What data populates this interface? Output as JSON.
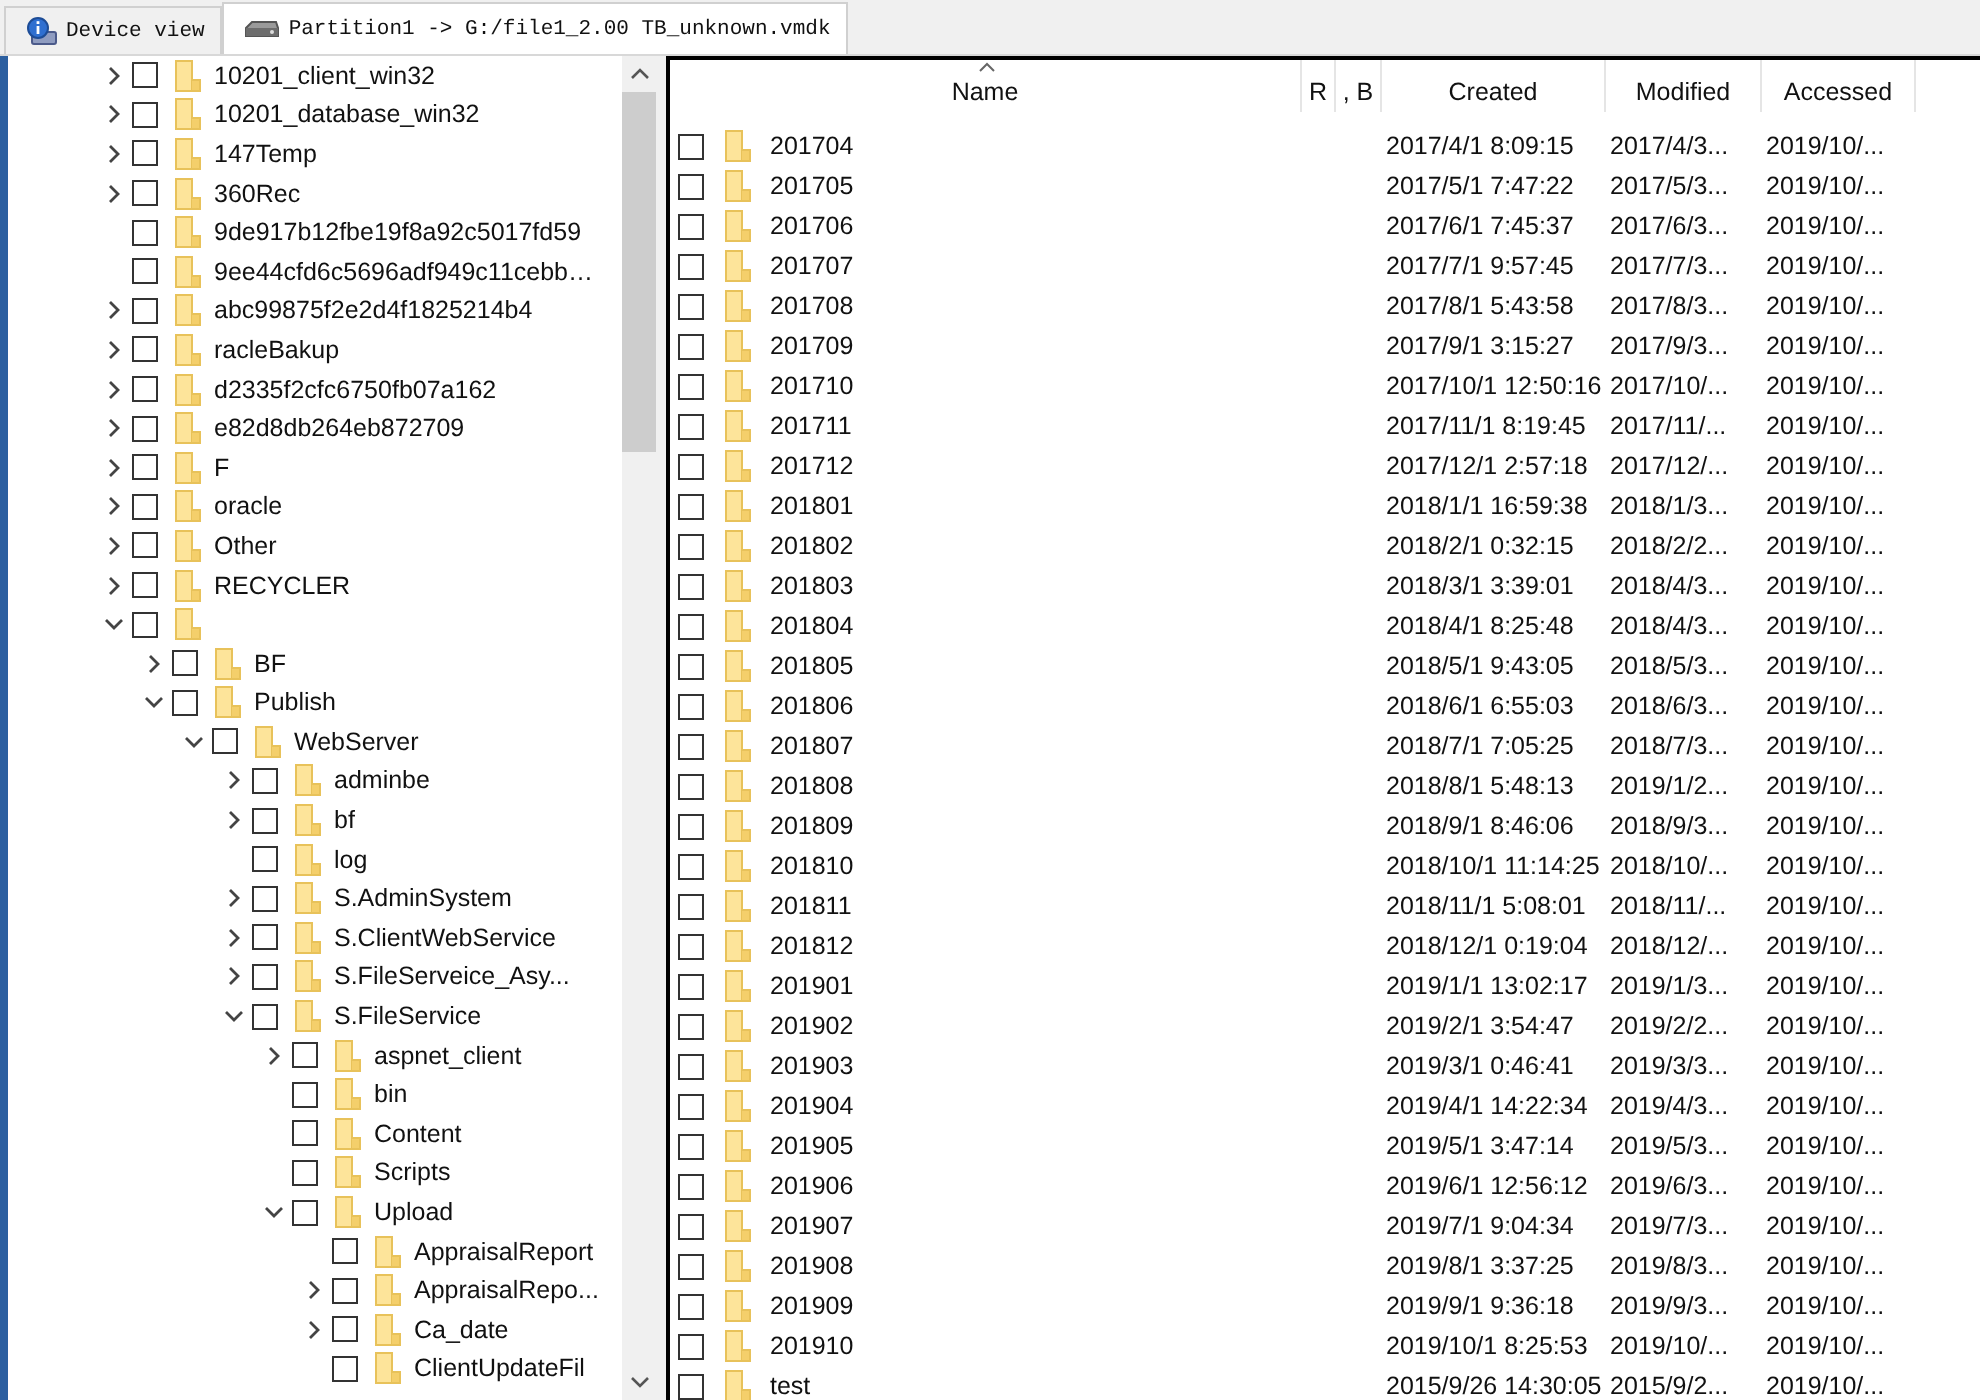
{
  "tabs": [
    {
      "label": "Device view",
      "kind": "device",
      "selected": false
    },
    {
      "label": "Partition1 -> G:/file1_2.00 TB_unknown.vmdk",
      "kind": "disk",
      "selected": true
    }
  ],
  "tree": [
    {
      "name": "10201_client_win32",
      "expanded": false,
      "checked": false
    },
    {
      "name": "10201_database_win32",
      "expanded": false,
      "checked": false
    },
    {
      "name": "147Temp",
      "expanded": false,
      "checked": false
    },
    {
      "name": "360Rec",
      "expanded": false,
      "checked": false
    },
    {
      "name": "9de917b12fbe19f8a92c5017fd59",
      "checked": false
    },
    {
      "name": "9ee44cfd6c5696adf949c11cebb…",
      "checked": false
    },
    {
      "name": "abc99875f2e2d4f1825214b4",
      "expanded": false,
      "checked": false
    },
    {
      "name": "racleBakup",
      "expanded": false,
      "checked": false
    },
    {
      "name": "d2335f2cfc6750fb07a162",
      "expanded": false,
      "checked": false
    },
    {
      "name": "e82d8db264eb872709",
      "expanded": false,
      "checked": false
    },
    {
      "name": "F",
      "expanded": false,
      "checked": false
    },
    {
      "name": "oracle",
      "expanded": false,
      "checked": false
    },
    {
      "name": "Other",
      "expanded": false,
      "checked": false
    },
    {
      "name": "RECYCLER",
      "expanded": false,
      "checked": false
    },
    {
      "expanded": true,
      "checked": false,
      "children": [
        {
          "name": "BF",
          "expanded": false,
          "checked": false
        },
        {
          "name": "Publish",
          "expanded": true,
          "checked": false,
          "children": [
            {
              "name": "WebServer",
              "expanded": true,
              "checked": false,
              "children": [
                {
                  "name": "adminbe",
                  "expanded": false,
                  "checked": false
                },
                {
                  "name": "bf",
                  "expanded": false,
                  "checked": false
                },
                {
                  "name": "log",
                  "checked": false
                },
                {
                  "name": "S.AdminSystem",
                  "expanded": false,
                  "checked": false
                },
                {
                  "name": "S.ClientWebService",
                  "expanded": false,
                  "checked": false
                },
                {
                  "name": "S.FileServeice_Asy...",
                  "expanded": false,
                  "checked": false
                },
                {
                  "name": "S.FileService",
                  "expanded": true,
                  "checked": false,
                  "children": [
                    {
                      "name": "aspnet_client",
                      "expanded": false,
                      "checked": false
                    },
                    {
                      "name": "bin",
                      "checked": false
                    },
                    {
                      "name": "Content",
                      "checked": false
                    },
                    {
                      "name": "Scripts",
                      "checked": false
                    },
                    {
                      "name": "Upload",
                      "expanded": true,
                      "checked": false,
                      "children": [
                        {
                          "name": "AppraisalReport",
                          "checked": false
                        },
                        {
                          "name": "AppraisalRepo...",
                          "expanded": false,
                          "checked": false
                        },
                        {
                          "name": "Ca_date",
                          "expanded": false,
                          "checked": false
                        },
                        {
                          "name": "ClientUpdateFil",
                          "checked": false
                        }
                      ]
                    }
                  ]
                }
              ]
            }
          ]
        }
      ]
    }
  ],
  "table": {
    "columns": [
      "Name",
      "R",
      ", B",
      "Created",
      "Modified",
      "Accessed"
    ],
    "rows": [
      {
        "name": "201704",
        "created": "2017/4/1 8:09:15",
        "modified": "2017/4/3...",
        "accessed": "2019/10/...",
        "checked": false
      },
      {
        "name": "201705",
        "created": "2017/5/1 7:47:22",
        "modified": "2017/5/3...",
        "accessed": "2019/10/...",
        "checked": false
      },
      {
        "name": "201706",
        "created": "2017/6/1 7:45:37",
        "modified": "2017/6/3...",
        "accessed": "2019/10/...",
        "checked": false
      },
      {
        "name": "201707",
        "created": "2017/7/1 9:57:45",
        "modified": "2017/7/3...",
        "accessed": "2019/10/...",
        "checked": false
      },
      {
        "name": "201708",
        "created": "2017/8/1 5:43:58",
        "modified": "2017/8/3...",
        "accessed": "2019/10/...",
        "checked": false
      },
      {
        "name": "201709",
        "created": "2017/9/1 3:15:27",
        "modified": "2017/9/3...",
        "accessed": "2019/10/...",
        "checked": false
      },
      {
        "name": "201710",
        "created": "2017/10/1 12:50:16",
        "modified": "2017/10/...",
        "accessed": "2019/10/...",
        "checked": false
      },
      {
        "name": "201711",
        "created": "2017/11/1 8:19:45",
        "modified": "2017/11/...",
        "accessed": "2019/10/...",
        "checked": false
      },
      {
        "name": "201712",
        "created": "2017/12/1 2:57:18",
        "modified": "2017/12/...",
        "accessed": "2019/10/...",
        "checked": false
      },
      {
        "name": "201801",
        "created": "2018/1/1 16:59:38",
        "modified": "2018/1/3...",
        "accessed": "2019/10/...",
        "checked": false
      },
      {
        "name": "201802",
        "created": "2018/2/1 0:32:15",
        "modified": "2018/2/2...",
        "accessed": "2019/10/...",
        "checked": false
      },
      {
        "name": "201803",
        "created": "2018/3/1 3:39:01",
        "modified": "2018/4/3...",
        "accessed": "2019/10/...",
        "checked": false
      },
      {
        "name": "201804",
        "created": "2018/4/1 8:25:48",
        "modified": "2018/4/3...",
        "accessed": "2019/10/...",
        "checked": false
      },
      {
        "name": "201805",
        "created": "2018/5/1 9:43:05",
        "modified": "2018/5/3...",
        "accessed": "2019/10/...",
        "checked": false
      },
      {
        "name": "201806",
        "created": "2018/6/1 6:55:03",
        "modified": "2018/6/3...",
        "accessed": "2019/10/...",
        "checked": false
      },
      {
        "name": "201807",
        "created": "2018/7/1 7:05:25",
        "modified": "2018/7/3...",
        "accessed": "2019/10/...",
        "checked": false
      },
      {
        "name": "201808",
        "created": "2018/8/1 5:48:13",
        "modified": "2019/1/2...",
        "accessed": "2019/10/...",
        "checked": false
      },
      {
        "name": "201809",
        "created": "2018/9/1 8:46:06",
        "modified": "2018/9/3...",
        "accessed": "2019/10/...",
        "checked": false
      },
      {
        "name": "201810",
        "created": "2018/10/1 11:14:25",
        "modified": "2018/10/...",
        "accessed": "2019/10/...",
        "checked": false
      },
      {
        "name": "201811",
        "created": "2018/11/1 5:08:01",
        "modified": "2018/11/...",
        "accessed": "2019/10/...",
        "checked": false
      },
      {
        "name": "201812",
        "created": "2018/12/1 0:19:04",
        "modified": "2018/12/...",
        "accessed": "2019/10/...",
        "checked": false
      },
      {
        "name": "201901",
        "created": "2019/1/1 13:02:17",
        "modified": "2019/1/3...",
        "accessed": "2019/10/...",
        "checked": false
      },
      {
        "name": "201902",
        "created": "2019/2/1 3:54:47",
        "modified": "2019/2/2...",
        "accessed": "2019/10/...",
        "checked": false
      },
      {
        "name": "201903",
        "created": "2019/3/1 0:46:41",
        "modified": "2019/3/3...",
        "accessed": "2019/10/...",
        "checked": false
      },
      {
        "name": "201904",
        "created": "2019/4/1 14:22:34",
        "modified": "2019/4/3...",
        "accessed": "2019/10/...",
        "checked": false
      },
      {
        "name": "201905",
        "created": "2019/5/1 3:47:14",
        "modified": "2019/5/3...",
        "accessed": "2019/10/...",
        "checked": false
      },
      {
        "name": "201906",
        "created": "2019/6/1 12:56:12",
        "modified": "2019/6/3...",
        "accessed": "2019/10/...",
        "checked": false
      },
      {
        "name": "201907",
        "created": "2019/7/1 9:04:34",
        "modified": "2019/7/3...",
        "accessed": "2019/10/...",
        "checked": false
      },
      {
        "name": "201908",
        "created": "2019/8/1 3:37:25",
        "modified": "2019/8/3...",
        "accessed": "2019/10/...",
        "checked": false
      },
      {
        "name": "201909",
        "created": "2019/9/1 9:36:18",
        "modified": "2019/9/3...",
        "accessed": "2019/10/...",
        "checked": false
      },
      {
        "name": "201910",
        "created": "2019/10/1 8:25:53",
        "modified": "2019/10/...",
        "accessed": "2019/10/...",
        "checked": false
      },
      {
        "name": "test",
        "created": "2015/9/26 14:30:05",
        "modified": "2015/9/2...",
        "accessed": "2019/10/...",
        "checked": false
      }
    ]
  }
}
